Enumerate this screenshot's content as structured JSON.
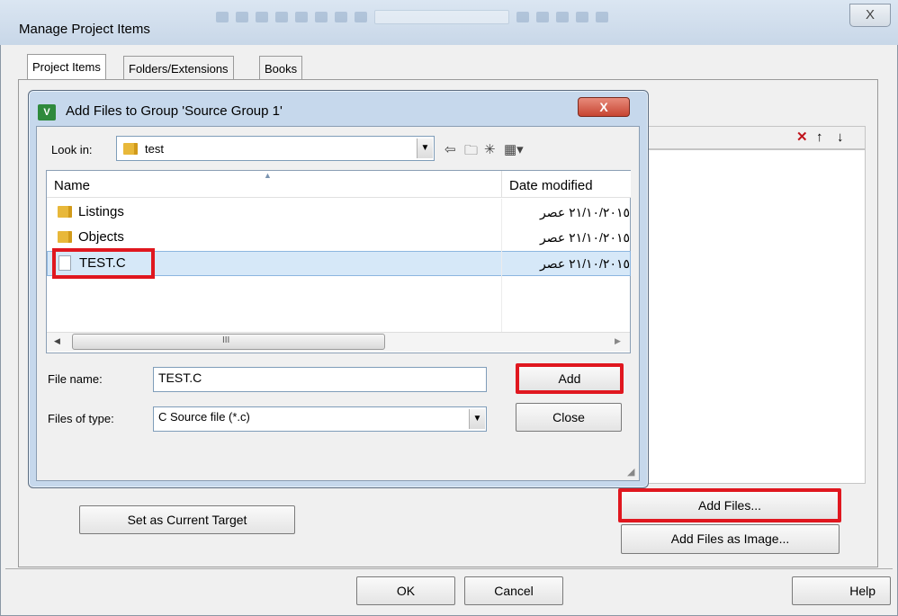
{
  "outer": {
    "title": "Manage Project Items",
    "close_label": "X",
    "tabs": [
      "Project Items",
      "Folders/Extensions",
      "Books"
    ],
    "list_icons": {
      "delete": "✕",
      "up": "↑",
      "down": "↓"
    },
    "buttons": {
      "set_target": "Set as Current Target",
      "add_files": "Add Files...",
      "add_files_image": "Add Files as Image...",
      "ok": "OK",
      "cancel": "Cancel",
      "help": "Help"
    }
  },
  "dialog": {
    "title": "Add Files to Group 'Source Group 1'",
    "icon_text": "V",
    "close_label": "X",
    "look_in_label": "Look in:",
    "look_in_value": "test",
    "columns": {
      "name": "Name",
      "date": "Date modified"
    },
    "files": [
      {
        "name": "Listings",
        "type": "folder",
        "date": "٢١/١٠/٢٠١٥ عصر"
      },
      {
        "name": "Objects",
        "type": "folder",
        "date": "٢١/١٠/٢٠١٥ عصر"
      },
      {
        "name": "TEST.C",
        "type": "file",
        "date": "٢١/١٠/٢٠١٥ عصر"
      }
    ],
    "scroll_grip": "III",
    "file_name_label": "File name:",
    "file_name_value": "TEST.C",
    "file_type_label": "Files of type:",
    "file_type_value": "C Source file (*.c)",
    "add_button": "Add",
    "close_button": "Close"
  },
  "colors": {
    "highlight": "#e0171f",
    "selection": "#d6e8f8",
    "folder": "#e8b83a"
  },
  "icons": [
    "folder-icon",
    "file-icon",
    "up-folder-icon",
    "new-folder-icon",
    "view-menu-icon",
    "back-arrow-icon",
    "sort-arrow-icon"
  ]
}
